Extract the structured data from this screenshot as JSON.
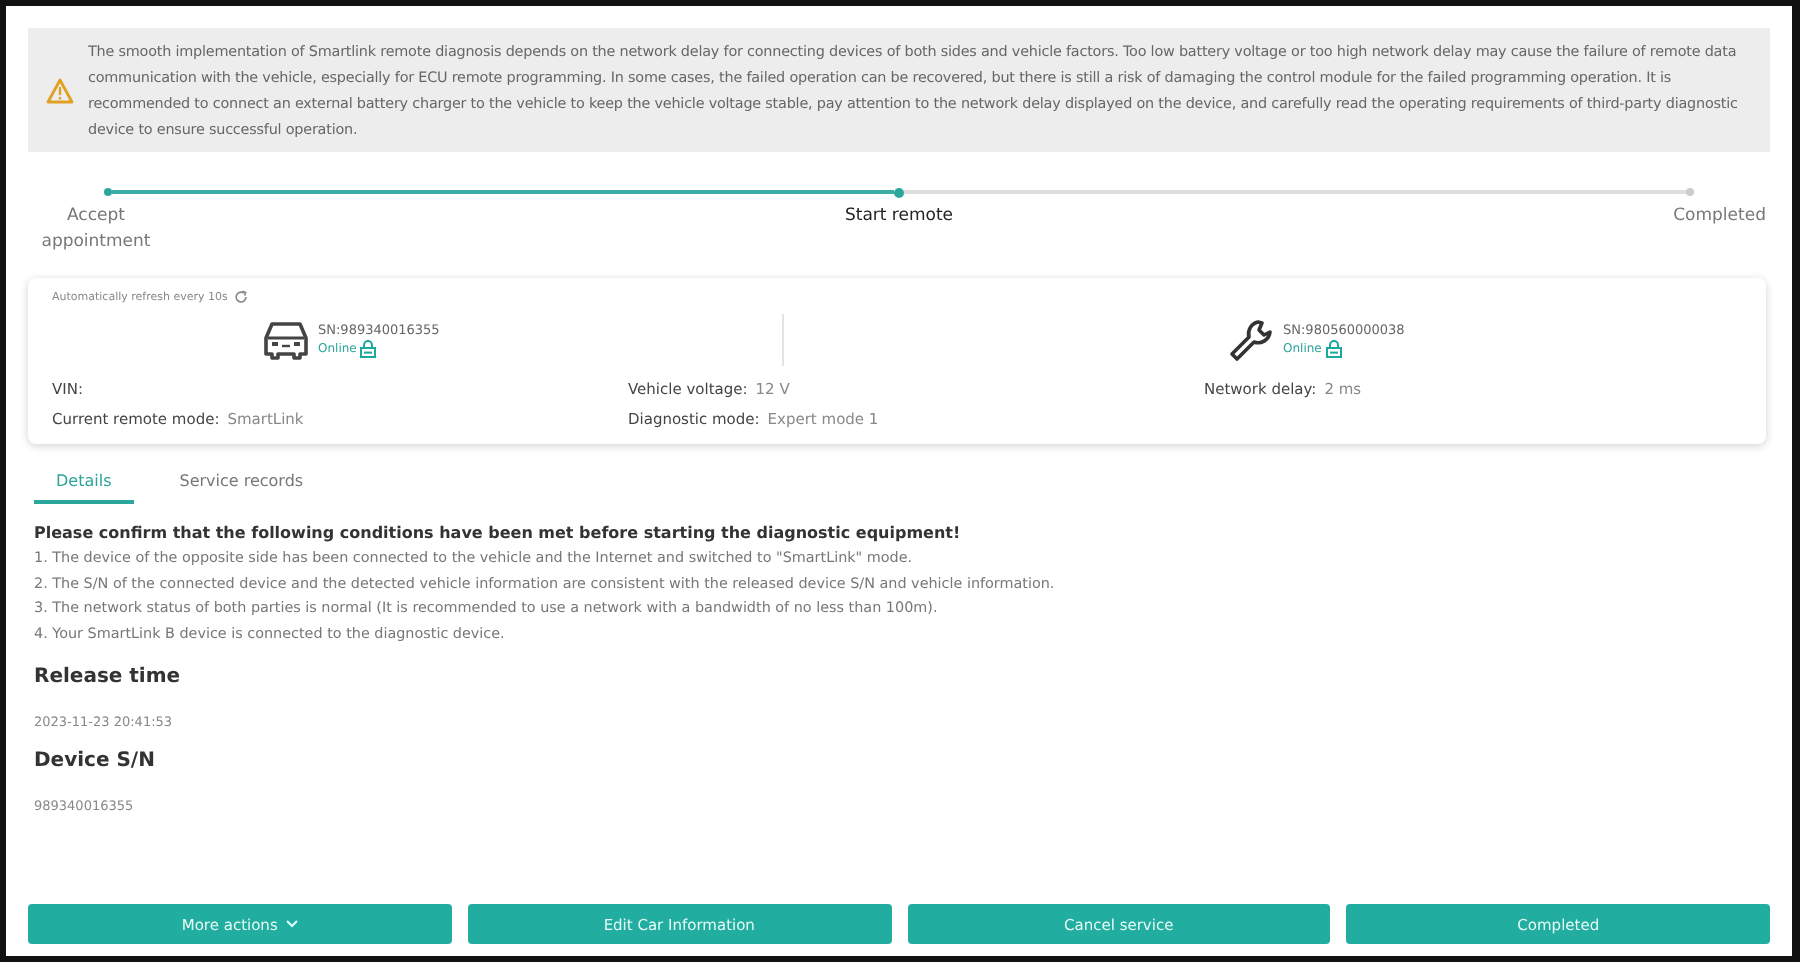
{
  "warning": {
    "text": "The smooth implementation of Smartlink remote diagnosis depends on the network delay for connecting devices of both sides and vehicle factors. Too low battery voltage or too high network delay may cause the failure of remote data communication with the vehicle, especially for ECU remote programming. In some cases, the failed operation can be recovered, but there is still a risk of damaging the control module for the failed programming operation. It is recommended to connect an external battery charger to the vehicle to keep the vehicle voltage stable, pay attention to the network delay displayed on the device, and carefully read the operating requirements of third-party diagnostic device to ensure successful operation."
  },
  "steps": [
    {
      "label": "Accept appointment",
      "done": true,
      "selected": false
    },
    {
      "label": "Start remote",
      "done": true,
      "selected": true
    },
    {
      "label": "Completed",
      "done": false,
      "selected": false
    }
  ],
  "connection": {
    "refresh": "Automatically refresh every 10s",
    "devices": [
      {
        "kind": "car",
        "sn": "SN:989340016355",
        "status": "Online"
      },
      {
        "kind": "tool",
        "sn": "SN:980560000038",
        "status": "Online"
      }
    ],
    "info": [
      {
        "label": "VIN:"
      },
      {
        "label": "Vehicle voltage:",
        "value": "12 V"
      },
      {
        "label": "Network delay:",
        "value": "2 ms"
      },
      {
        "label": "Current remote mode:",
        "value": "SmartLink"
      },
      {
        "label": "Diagnostic mode:",
        "value": "Expert mode 1"
      }
    ]
  },
  "tabs": [
    {
      "label": "Details",
      "selected": true
    },
    {
      "label": "Service records",
      "selected": false
    }
  ],
  "conditions": {
    "heading": "Please confirm that the following conditions have been met before starting the diagnostic equipment!",
    "items": [
      "1. The device of the opposite side has been connected to the vehicle and the Internet and switched to \"SmartLink\" mode.",
      "2. The S/N of the connected device and the detected vehicle information are consistent with the released device S/N and vehicle information.",
      "3. The network status of both parties is normal (It is recommended to use a network with a bandwidth of no less than 100m).",
      "4. Your SmartLink B device is connected to the diagnostic device."
    ]
  },
  "fields": [
    {
      "label": "Release time",
      "value": "2023-11-23 20:41:53"
    },
    {
      "label": "Device S/N",
      "value": "989340016355"
    }
  ],
  "buttons": [
    {
      "label": "More actions",
      "dropdown": true
    },
    {
      "label": "Edit Car Information",
      "dropdown": false
    },
    {
      "label": "Cancel service",
      "dropdown": false
    },
    {
      "label": "Completed",
      "dropdown": false
    }
  ]
}
